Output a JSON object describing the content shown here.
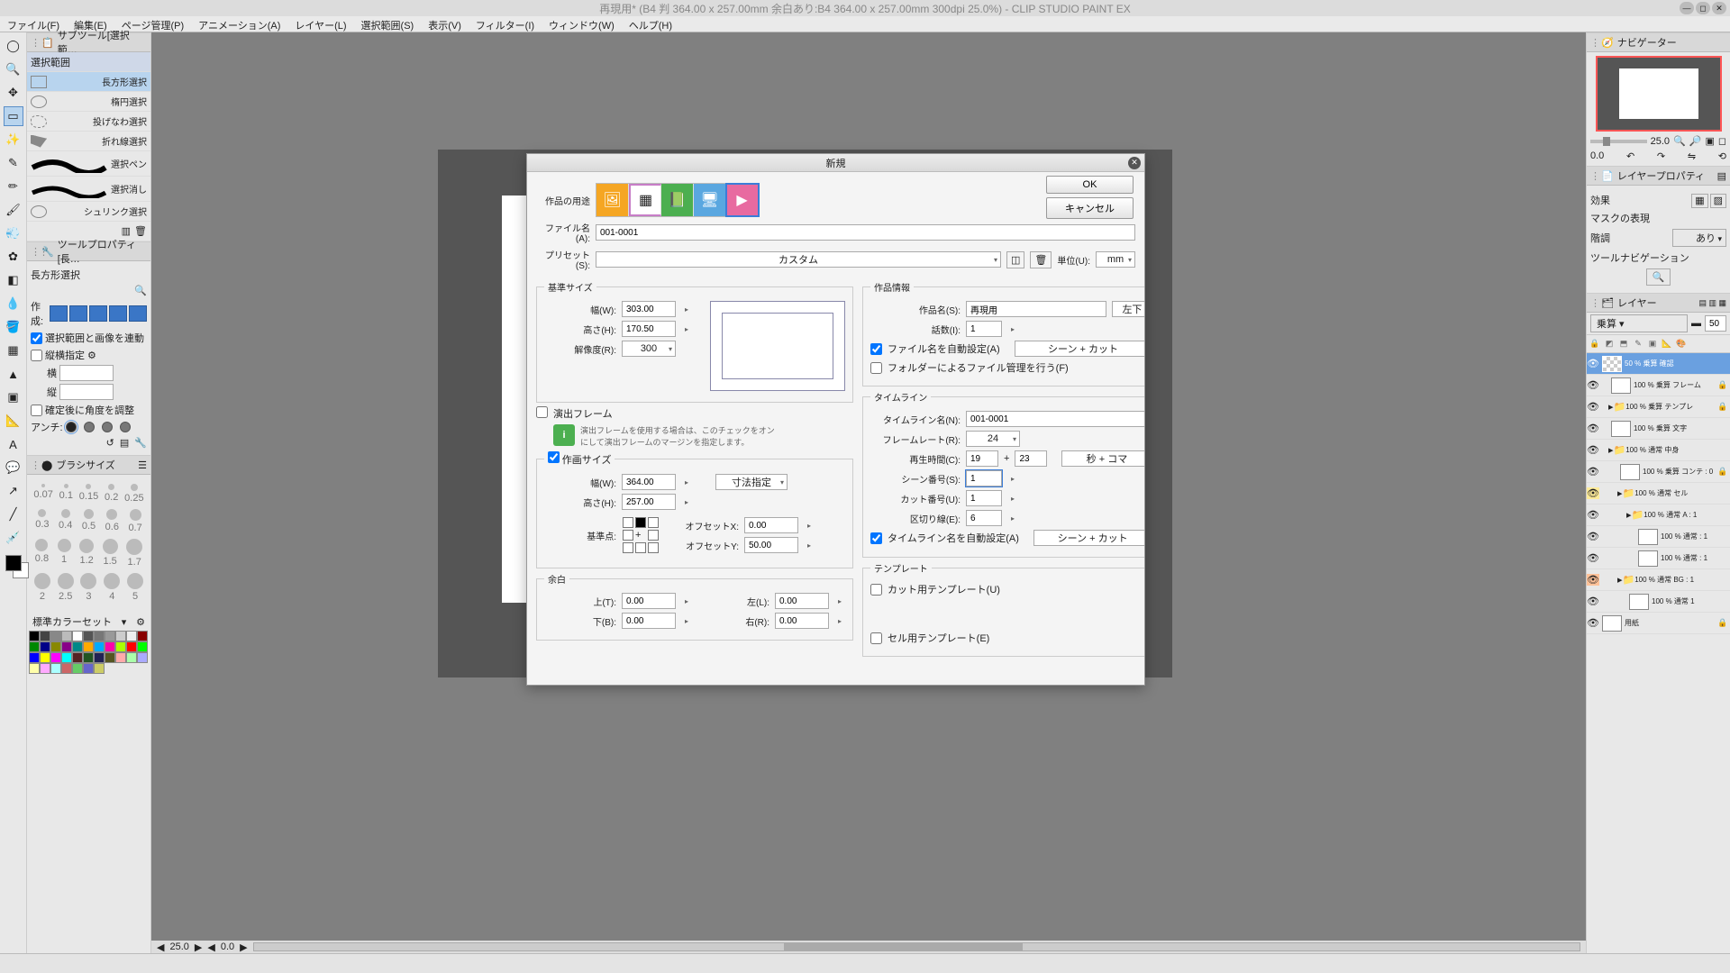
{
  "win": {
    "title": "再現用* (B4 判 364.00 x 257.00mm 余白あり:B4 364.00 x 257.00mm 300dpi 25.0%)  - CLIP STUDIO PAINT EX"
  },
  "menu": [
    "ファイル(F)",
    "編集(E)",
    "ページ管理(P)",
    "アニメーション(A)",
    "レイヤー(L)",
    "選択範囲(S)",
    "表示(V)",
    "フィルター(I)",
    "ウィンドウ(W)",
    "ヘルプ(H)"
  ],
  "subtool": {
    "title": "サブツール[選択範…",
    "tab": "選択範囲",
    "items": [
      "長方形選択",
      "楕円選択",
      "投げなわ選択",
      "折れ線選択",
      "選択ペン",
      "選択消し",
      "シュリンク選択"
    ]
  },
  "toolprop": {
    "title": "ツールプロパティ[長…",
    "name": "長方形選択",
    "make": "作成:",
    "linkchk": "選択範囲と画像を連動",
    "ratiochk": "縦横指定",
    "ratiolbls": [
      "横",
      "縦"
    ],
    "anglechk": "確定後に角度を調整",
    "anti": "アンチ:"
  },
  "brush": {
    "title": "ブラシサイズ",
    "sizes": [
      [
        "0.07",
        "0.1",
        "0.15",
        "0.2",
        "0.25"
      ],
      [
        "0.3",
        "0.4",
        "0.5",
        "0.6",
        "0.7"
      ],
      [
        "0.8",
        "1",
        "1.2",
        "1.5",
        "1.7"
      ],
      [
        "2",
        "2.5",
        "3",
        "4",
        "5"
      ]
    ]
  },
  "colorset": {
    "title": "標準カラーセット",
    "colors": [
      "#000",
      "#444",
      "#888",
      "#bbb",
      "#fff",
      "#555",
      "#777",
      "#999",
      "#ccc",
      "#eee",
      "#800",
      "#080",
      "#008",
      "#880",
      "#808",
      "#088",
      "#fa0",
      "#0af",
      "#f0a",
      "#af0",
      "#f00",
      "#0f0",
      "#00f",
      "#ff0",
      "#f0f",
      "#0ff",
      "#522",
      "#252",
      "#225",
      "#552",
      "#faa",
      "#afa",
      "#aaf",
      "#ffa",
      "#faf",
      "#aff",
      "#c66",
      "#6c6",
      "#66c",
      "#cc6"
    ]
  },
  "nav": {
    "title": "ナビゲーター",
    "zoom": "25.0",
    "angle": "0.0"
  },
  "lprop": {
    "title": "レイヤープロパティ",
    "effect": "効果",
    "mask": "マスクの表現",
    "tone": "階調",
    "toneval": "あり",
    "toolnav": "ツールナビゲーション"
  },
  "layers": {
    "title": "レイヤー",
    "blend": "乗算",
    "opacity": "50",
    "rows": [
      {
        "sel": true,
        "vis": "👁",
        "ind": 0,
        "name": "50 % 乗算 確認",
        "lock": false,
        "th": "dark"
      },
      {
        "vis": "👁",
        "ind": 1,
        "name": "100 % 乗算 フレーム",
        "lock": true
      },
      {
        "vis": "👁",
        "ind": 1,
        "name": "100 % 乗算 テンプレ",
        "lock": true,
        "folder": true
      },
      {
        "vis": "👁",
        "ind": 1,
        "name": "100 % 乗算 文字",
        "lock": false
      },
      {
        "vis": "👁",
        "ind": 1,
        "name": "100 % 通常 中身",
        "lock": false,
        "folder": true
      },
      {
        "vis": "👁",
        "ind": 2,
        "name": "100 % 乗算 コンテ : 0",
        "lock": true
      },
      {
        "vis": "👁",
        "ind": 2,
        "name": "100 % 通常 セル",
        "lock": false,
        "folder": true,
        "hl": "y"
      },
      {
        "vis": "👁",
        "ind": 3,
        "name": "100 % 通常 A : 1",
        "lock": false,
        "folder": true
      },
      {
        "vis": "👁",
        "ind": 4,
        "name": "100 % 通常 : 1",
        "lock": false
      },
      {
        "vis": "👁",
        "ind": 4,
        "name": "100 % 通常 : 1",
        "lock": false
      },
      {
        "vis": "👁",
        "ind": 2,
        "name": "100 % 通常 BG : 1",
        "lock": false,
        "folder": true,
        "hl": "o"
      },
      {
        "vis": "👁",
        "ind": 3,
        "name": "100 % 通常 1",
        "lock": false
      },
      {
        "vis": "👁",
        "ind": 0,
        "name": "用紙",
        "lock": true
      }
    ]
  },
  "status": {
    "zoom": "25.0",
    "angle": "0.0"
  },
  "dlg": {
    "title": "新規",
    "ok": "OK",
    "cancel": "キャンセル",
    "purpose_lbl": "作品の用途",
    "file_lbl": "ファイル名(A):",
    "file_val": "001-0001",
    "preset_lbl": "プリセット(S):",
    "preset_val": "カスタム",
    "unit_lbl": "単位(U):",
    "unit_val": "mm",
    "base": {
      "title": "基準サイズ",
      "w_lbl": "幅(W):",
      "w": "303.00",
      "h_lbl": "高さ(H):",
      "h": "170.50",
      "r_lbl": "解像度(R):",
      "r": "300"
    },
    "frame": {
      "chk_lbl": "演出フレーム",
      "info": "演出フレームを使用する場合は、このチェックをオンにして演出フレームのマージンを指定します。"
    },
    "draw": {
      "title": "作画サイズ",
      "w_lbl": "幅(W):",
      "w": "364.00",
      "h_lbl": "高さ(H):",
      "h": "257.00",
      "dim_btn": "寸法指定",
      "ref_lbl": "基準点:",
      "ox_lbl": "オフセットX:",
      "ox": "0.00",
      "oy_lbl": "オフセットY:",
      "oy": "50.00"
    },
    "margin": {
      "title": "余白",
      "t_lbl": "上(T):",
      "t": "0.00",
      "b_lbl": "下(B):",
      "b": "0.00",
      "l_lbl": "左(L):",
      "l": "0.00",
      "r_lbl": "右(R):",
      "r": "0.00"
    },
    "info": {
      "title": "作品情報",
      "name_lbl": "作品名(S):",
      "name": "再現用",
      "corner": "左下",
      "ep_lbl": "話数(I):",
      "ep": "1",
      "auto_lbl": "ファイル名を自動設定(A)",
      "auto_val": "シーン + カット",
      "folder_lbl": "フォルダーによるファイル管理を行う(F)"
    },
    "tl": {
      "title": "タイムライン",
      "name_lbl": "タイムライン名(N):",
      "name": "001-0001",
      "fr_lbl": "フレームレート(R):",
      "fr": "24",
      "pt_lbl": "再生時間(C):",
      "pt1": "19",
      "pt2": "23",
      "pt_unit": "秒 + コマ",
      "scene_lbl": "シーン番号(S):",
      "scene": "1",
      "cut_lbl": "カット番号(U):",
      "cut": "1",
      "sep_lbl": "区切り線(E):",
      "sep": "6",
      "auto_lbl": "タイムライン名を自動設定(A)",
      "auto_val": "シーン + カット"
    },
    "tpl": {
      "title": "テンプレート",
      "cut_lbl": "カット用テンプレート(U)",
      "cel_lbl": "セル用テンプレート(E)"
    }
  }
}
